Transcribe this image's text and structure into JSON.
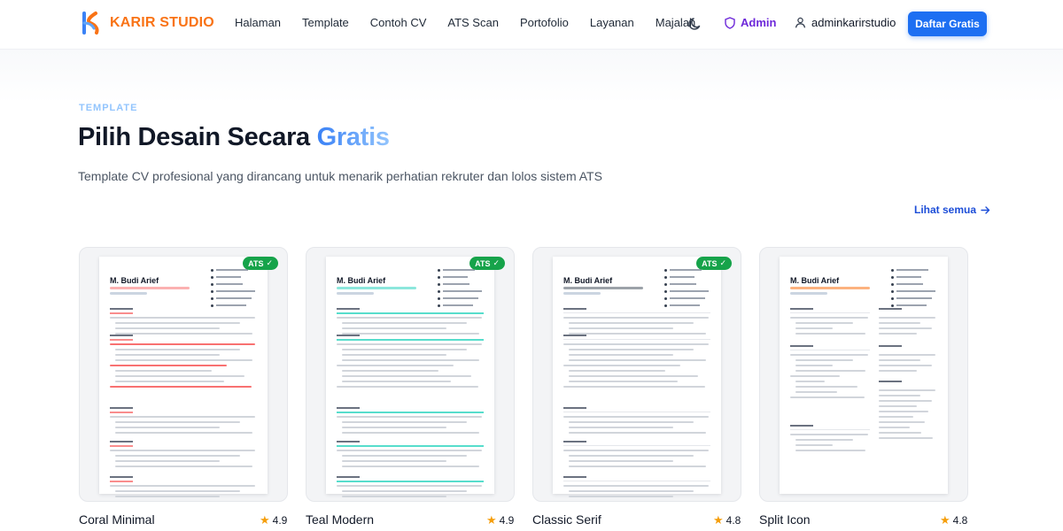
{
  "brand": {
    "name": "KARIR STUDIO"
  },
  "nav": {
    "links": [
      "Halaman",
      "Template",
      "Contoh CV",
      "ATS Scan",
      "Portofolio",
      "Layanan",
      "Majalah"
    ],
    "admin_label": "Admin",
    "user_label": "adminkarirstudio",
    "cta_label": "Daftar Gratis"
  },
  "hero": {
    "eyebrow": "TEMPLATE",
    "title_main": "Pilih Desain Secara ",
    "title_highlight": "Gratis",
    "subtitle": "Template CV profesional yang dirancang untuk menarik perhatian rekruter dan lolos sistem ATS",
    "see_all": "Lihat semua"
  },
  "templates": [
    {
      "name": "Coral Minimal",
      "rating": "4.9",
      "ats_badge": "ATS",
      "accent": "#f87171",
      "cv_name": "M. Budi Arief"
    },
    {
      "name": "Teal Modern",
      "rating": "4.9",
      "ats_badge": "ATS",
      "accent": "#2dd4bf",
      "cv_name": "M. Budi Arief"
    },
    {
      "name": "Classic Serif",
      "rating": "4.8",
      "ats_badge": "ATS",
      "accent": "#4b5563",
      "cv_name": "M. Budi Arief"
    },
    {
      "name": "Split Icon",
      "rating": "4.8",
      "ats_badge": "",
      "accent": "#f97316",
      "cv_name": "M. Budi Arief"
    }
  ],
  "colors": {
    "brand_orange": "#f97316",
    "primary_blue": "#1d6ff2",
    "admin_purple": "#6d28d9",
    "ats_green": "#16a34a",
    "star": "#f59e0b"
  }
}
